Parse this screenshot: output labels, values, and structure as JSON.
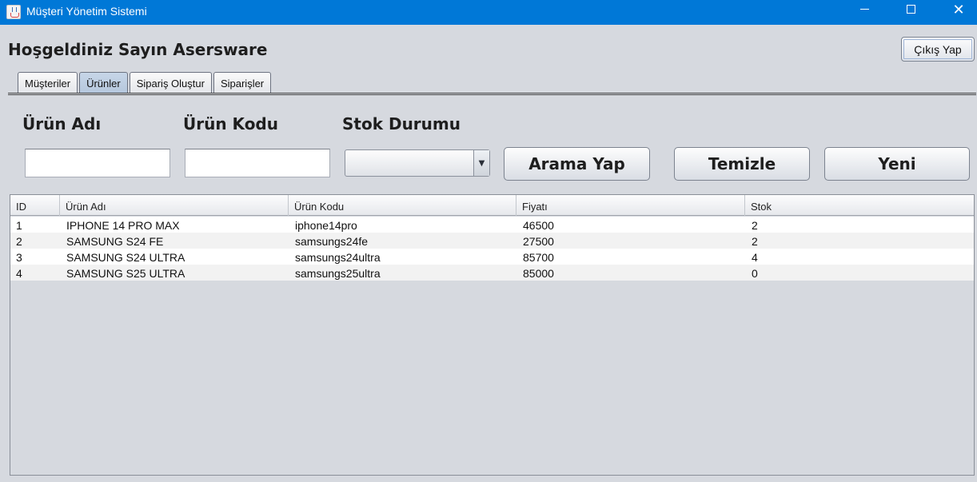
{
  "window": {
    "title": "Müşteri Yönetim Sistemi",
    "minimize": "—",
    "maximize": "☐",
    "close": "✕"
  },
  "header": {
    "welcome": "Hoşgeldiniz Sayın Asersware",
    "logout_label": "Çıkış Yap"
  },
  "tabs": [
    {
      "label": "Müşteriler",
      "active": false
    },
    {
      "label": "Ürünler",
      "active": true
    },
    {
      "label": "Sipariş Oluştur",
      "active": false
    },
    {
      "label": "Siparişler",
      "active": false
    }
  ],
  "search": {
    "name_label": "Ürün Adı",
    "name_value": "",
    "code_label": "Ürün Kodu",
    "code_value": "",
    "stock_label": "Stok Durumu",
    "stock_value": "",
    "search_button": "Arama Yap",
    "clear_button": "Temizle",
    "new_button": "Yeni"
  },
  "table": {
    "columns": [
      "ID",
      "Ürün Adı",
      "Ürün Kodu",
      "Fiyatı",
      "Stok"
    ],
    "rows": [
      [
        "1",
        "IPHONE 14 PRO MAX",
        "iphone14pro",
        "46500",
        "2"
      ],
      [
        "2",
        "SAMSUNG S24 FE",
        "samsungs24fe",
        "27500",
        "2"
      ],
      [
        "3",
        "SAMSUNG S24 ULTRA",
        "samsungs24ultra",
        "85700",
        "4"
      ],
      [
        "4",
        "SAMSUNG S25 ULTRA",
        "samsungs25ultra",
        "85000",
        "0"
      ]
    ]
  },
  "colors": {
    "titlebar": "#0078d7",
    "background": "#d6d9df",
    "active_tab": "#b5c7dd"
  }
}
